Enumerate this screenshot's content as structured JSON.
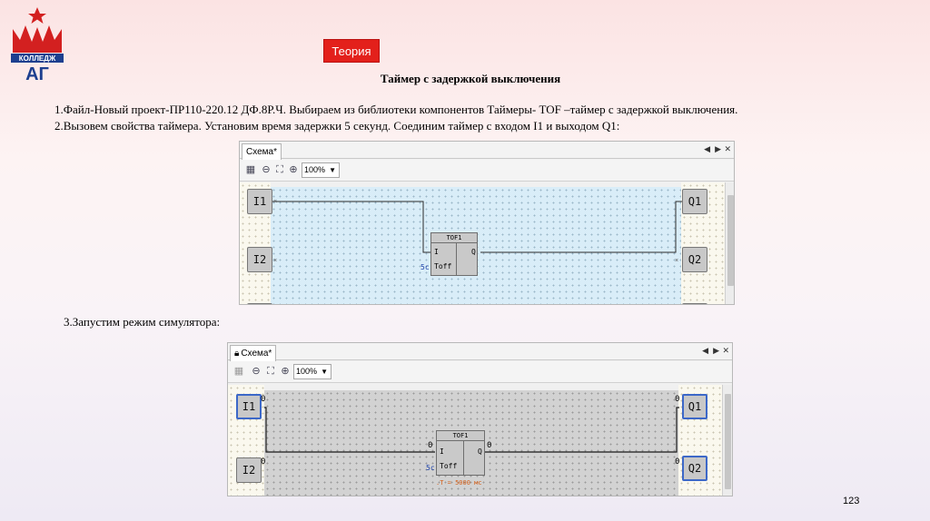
{
  "logo": {
    "text": "КОЛЛЕДЖ",
    "letters": "АГ",
    "colors": {
      "red": "#d32020",
      "blue": "#1d3f8f"
    }
  },
  "badge": {
    "label": "Теория",
    "color": "#e3201b"
  },
  "title": "Таймер с задержкой выключения",
  "steps": {
    "s1": "1.Файл-Новый проект-ПР110-220.12 ДФ.8Р.Ч.  Выбираем из библиотеки компонентов Таймеры- TOF –таймер с задержкой выключения.",
    "s2": "2.Вызовем свойства таймера. Установим время задержки 5 секунд. Соединим таймер с входом I1 и выходом Q1:",
    "s3": "3.Запустим режим симулятора:"
  },
  "window1": {
    "tab": "Схема*",
    "zoom": "100%",
    "inputs": [
      "I1",
      "I2"
    ],
    "outputs": [
      "Q1",
      "Q2"
    ],
    "block": {
      "name": "TOF1",
      "in": "I",
      "out": "Q",
      "param": "Toff",
      "param_value": "5c"
    }
  },
  "window2": {
    "tab": "Схема*",
    "zoom": "100%",
    "inputs": [
      "I1",
      "I2"
    ],
    "outputs": [
      "Q1",
      "Q2"
    ],
    "pin_values": {
      "i1": "0",
      "i2": "0",
      "q1": "0",
      "q2": "0",
      "block_in": "0",
      "block_out": "0"
    },
    "block": {
      "name": "TOF1",
      "in": "I",
      "out": "Q",
      "param": "Toff",
      "param_value": "5c",
      "sim_time": ".T = 5000 мс"
    }
  },
  "page_number": "123"
}
